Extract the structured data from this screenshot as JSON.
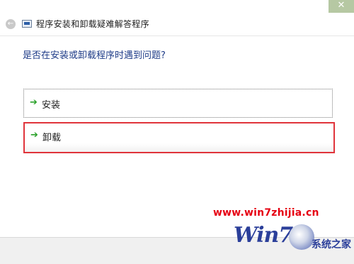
{
  "window": {
    "title": "程序安装和卸载疑难解答程序",
    "close_glyph": "✕",
    "back_glyph": "←"
  },
  "content": {
    "question": "是否在安装或卸载程序时遇到问题?",
    "options": [
      {
        "label": "安装",
        "arrow": "➔"
      },
      {
        "label": "卸载",
        "arrow": "➔"
      }
    ]
  },
  "watermark": {
    "url": "www.win7zhijia.cn",
    "logo_text": "Win7",
    "site_name": "系统之家"
  },
  "colors": {
    "highlight_border": "#e0343b",
    "question_text": "#1f3c88",
    "arrow": "#2aa12a",
    "close_button": "#b6c8a3"
  }
}
